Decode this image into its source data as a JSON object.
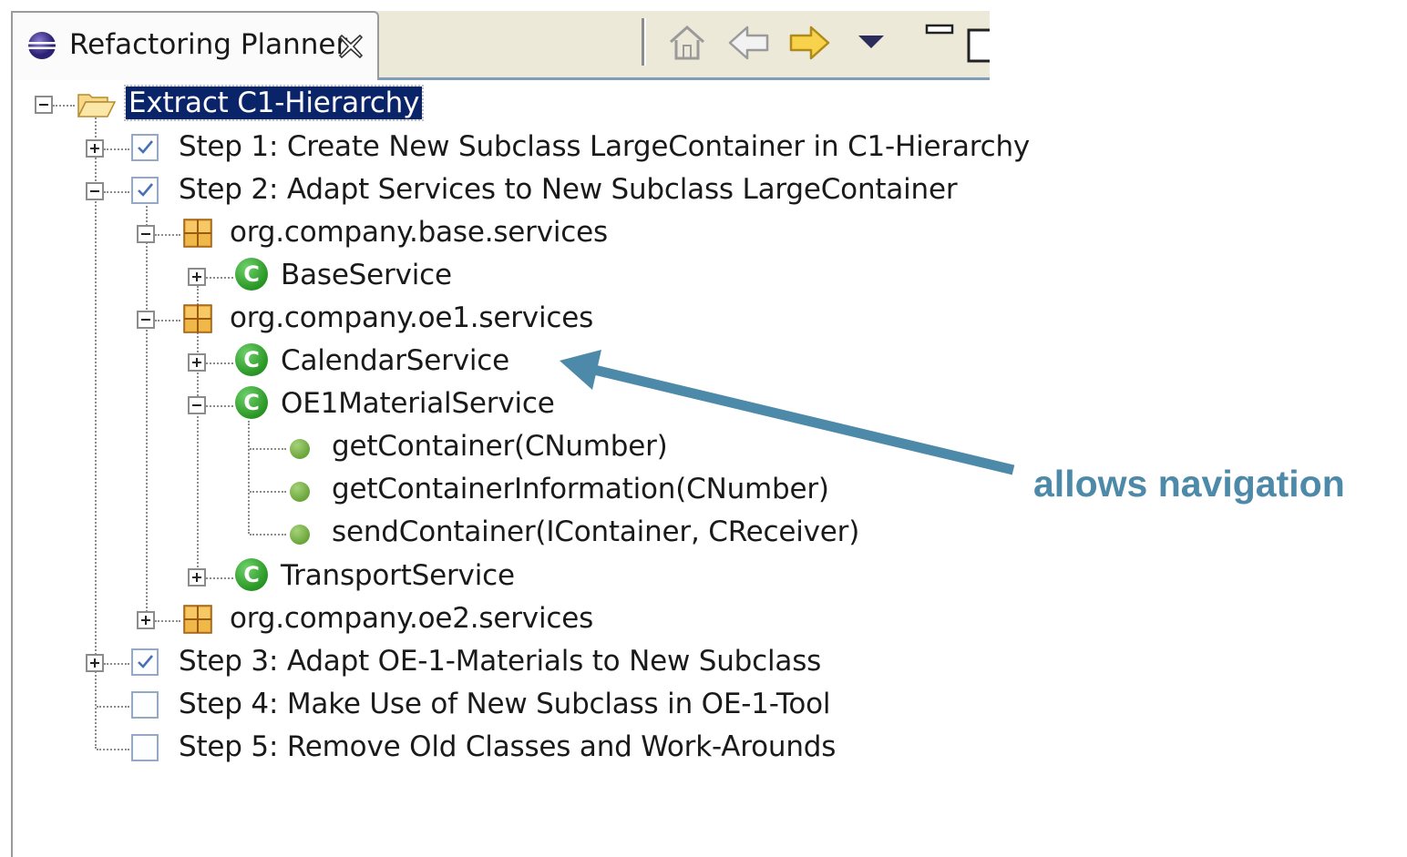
{
  "view": {
    "title": "Refactoring Planner",
    "toolbar": [
      "home-icon",
      "back-arrow-icon",
      "forward-arrow-icon",
      "view-menu-icon",
      "minimize-icon",
      "maximize-icon"
    ]
  },
  "tree": {
    "root": "Extract C1-Hierarchy",
    "step1": "Step 1: Create New Subclass LargeContainer in C1-Hierarchy",
    "step2": "Step 2: Adapt Services to New Subclass LargeContainer",
    "pkg_base": "org.company.base.services",
    "cls_base": "BaseService",
    "pkg_oe1": "org.company.oe1.services",
    "cls_calendar": "CalendarService",
    "cls_material": "OE1MaterialService",
    "m_get": "getContainer(CNumber)",
    "m_info": "getContainerInformation(CNumber)",
    "m_send": "sendContainer(IContainer, CReceiver)",
    "cls_transport": "TransportService",
    "pkg_oe2": "org.company.oe2.services",
    "step3": "Step 3: Adapt OE-1-Materials to New Subclass",
    "step4": "Step 4: Make Use of New Subclass in OE-1-Tool",
    "step5": "Step 5: Remove Old Classes and Work-Arounds",
    "class_icon_letter": "C"
  },
  "steps_checked": [
    true,
    true,
    true,
    false,
    false
  ],
  "annotation": {
    "text": "allows navigation",
    "color": "#4d89a8"
  }
}
